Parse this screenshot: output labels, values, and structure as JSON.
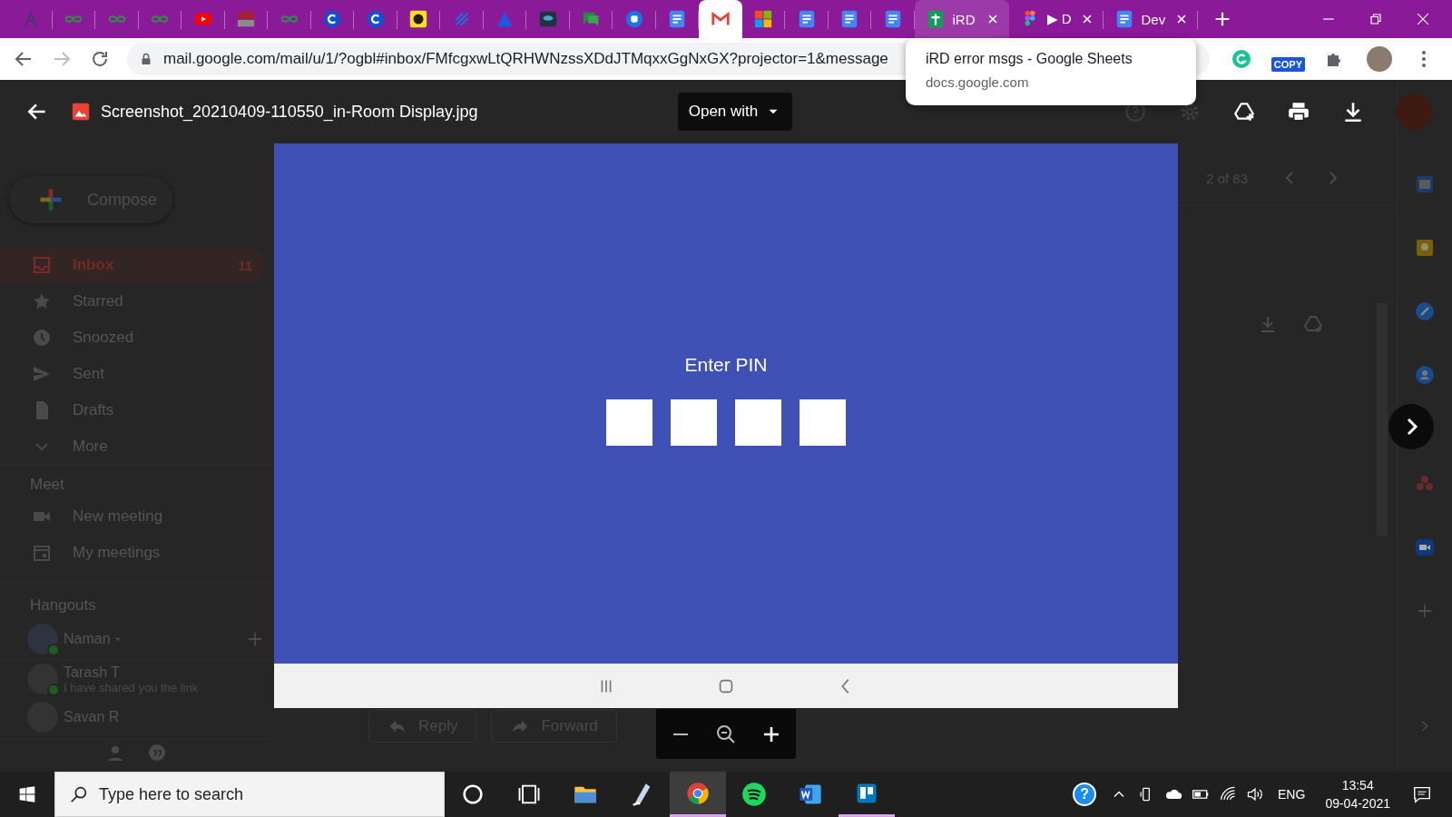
{
  "browser": {
    "tabs": [
      {
        "kind": "letter",
        "selected": false,
        "hovered": false
      },
      {
        "kind": "loops",
        "selected": false,
        "hovered": false
      },
      {
        "kind": "loops",
        "selected": false,
        "hovered": false
      },
      {
        "kind": "loops",
        "selected": false,
        "hovered": false
      },
      {
        "kind": "play",
        "selected": false,
        "hovered": false
      },
      {
        "kind": "blocks",
        "selected": false,
        "hovered": false
      },
      {
        "kind": "loops",
        "selected": false,
        "hovered": false
      },
      {
        "kind": "ring",
        "selected": false,
        "hovered": false
      },
      {
        "kind": "ring",
        "selected": false,
        "hovered": false
      },
      {
        "kind": "yellow",
        "selected": false,
        "hovered": false
      },
      {
        "kind": "slashes",
        "selected": false,
        "hovered": false
      },
      {
        "kind": "triangle",
        "selected": false,
        "hovered": false
      },
      {
        "kind": "eye",
        "selected": false,
        "hovered": false
      },
      {
        "kind": "chat",
        "selected": false,
        "hovered": false
      },
      {
        "kind": "badge",
        "selected": false,
        "hovered": false
      },
      {
        "kind": "doc",
        "selected": false,
        "hovered": false
      },
      {
        "kind": "mail",
        "selected": true,
        "hovered": false
      },
      {
        "kind": "squares",
        "selected": false,
        "hovered": false
      },
      {
        "kind": "doc",
        "selected": false,
        "hovered": false
      },
      {
        "kind": "doc",
        "selected": false,
        "hovered": false
      },
      {
        "kind": "doc",
        "selected": false,
        "hovered": false
      },
      {
        "kind": "sheet",
        "title": "iRD",
        "selected": false,
        "hovered": true
      },
      {
        "kind": "dots",
        "title": "▶ D",
        "selected": false,
        "hovered": false
      },
      {
        "kind": "doc",
        "title": "Dev",
        "selected": false,
        "hovered": false
      }
    ],
    "tooltip": {
      "title": "iRD error msgs - Google Sheets",
      "subtitle": "docs.google.com"
    },
    "url": "mail.google.com/mail/u/1/?ogbl#inbox/FMfcgxwLtQRHWNzssXDdJTMqxxGgNxGX?projector=1&message",
    "extensions": [
      {
        "kind": "grammar"
      },
      {
        "kind": "copy",
        "label": "COPY"
      },
      {
        "kind": "puzzle"
      },
      {
        "kind": "avatar"
      },
      {
        "kind": "menu"
      }
    ]
  },
  "mail": {
    "compose": "Compose",
    "folders": [
      {
        "kind": "inbox",
        "label": "Inbox",
        "count": "11",
        "selected": true
      },
      {
        "kind": "star",
        "label": "Starred",
        "selected": false
      },
      {
        "kind": "clock",
        "label": "Snoozed",
        "selected": false
      },
      {
        "kind": "send",
        "label": "Sent",
        "selected": false
      },
      {
        "kind": "draft",
        "label": "Drafts",
        "selected": false
      },
      {
        "kind": "more",
        "label": "More",
        "selected": false
      }
    ],
    "meet": {
      "heading": "Meet",
      "items": [
        {
          "kind": "video",
          "label": "New meeting"
        },
        {
          "kind": "calendar",
          "label": "My meetings"
        }
      ]
    },
    "hangouts": {
      "heading": "Hangouts",
      "user": "Naman",
      "contacts": [
        {
          "name": "Tarash T",
          "message": "I have shared you the link",
          "online": true
        },
        {
          "name": "Savan R",
          "online": false
        }
      ]
    },
    "pager": "2 of 83",
    "actions": [
      {
        "kind": "reply",
        "label": "Reply"
      },
      {
        "kind": "forward",
        "label": "Forward"
      }
    ],
    "rail": [
      {
        "kind": "calendar"
      },
      {
        "kind": "note"
      },
      {
        "kind": "check"
      },
      {
        "kind": "person"
      },
      {
        "kind": "dots"
      },
      {
        "kind": "camera"
      },
      {
        "kind": "plus"
      }
    ]
  },
  "viewer": {
    "filename": "Screenshot_20210409-110550_in-Room Display.jpg",
    "open_with": "Open with",
    "image": {
      "prompt": "Enter PIN",
      "pin_fields": [
        {
          "kind": "digit"
        },
        {
          "kind": "digit"
        },
        {
          "kind": "digit"
        },
        {
          "kind": "digit"
        }
      ]
    }
  },
  "taskbar": {
    "search_placeholder": "Type here to search",
    "apps": [
      {
        "kind": "circle",
        "selected": false,
        "open": false
      },
      {
        "kind": "taskview",
        "selected": false,
        "open": false
      },
      {
        "kind": "folder",
        "selected": false,
        "open": false
      },
      {
        "kind": "pen",
        "selected": false,
        "open": false
      },
      {
        "kind": "browser",
        "selected": true,
        "open": true
      },
      {
        "kind": "music",
        "selected": false,
        "open": false
      },
      {
        "kind": "word",
        "selected": false,
        "open": false
      },
      {
        "kind": "board",
        "selected": false,
        "open": true
      }
    ],
    "help": "?",
    "language": "ENG",
    "time": "13:54",
    "date": "09-04-2021"
  }
}
